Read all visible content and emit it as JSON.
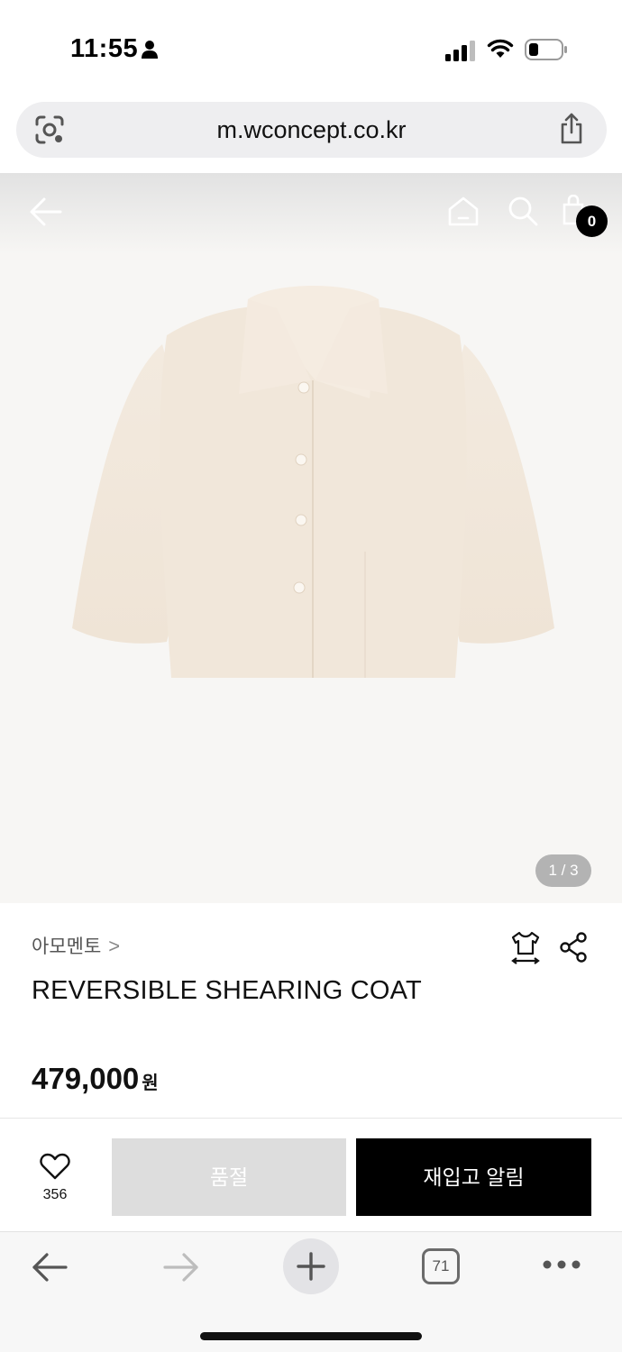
{
  "status_bar": {
    "time": "11:55"
  },
  "browser": {
    "url": "m.wconcept.co.kr",
    "tab_count": "71"
  },
  "header": {
    "cart_count": "0"
  },
  "gallery": {
    "pager": "1 / 3"
  },
  "product": {
    "brand": "아모멘토",
    "brand_chevron": ">",
    "name": "REVERSIBLE SHEARING COAT",
    "price": "479,000",
    "currency": "원"
  },
  "actions": {
    "wish_count": "356",
    "soldout_label": "품절",
    "restock_label": "재입고 알림"
  },
  "icons": {
    "person": "person-icon",
    "signal": "signal-icon",
    "wifi": "wifi-icon",
    "battery": "battery-icon",
    "lens": "camera-lens-icon",
    "share": "share-icon",
    "back": "arrow-left-icon",
    "home": "home-icon",
    "search": "search-icon",
    "bag": "shopping-bag-icon",
    "size": "size-guide-icon",
    "heart": "heart-icon",
    "plus": "plus-icon",
    "more": "more-icon"
  },
  "colors": {
    "primary_button": "#000000",
    "disabled_button": "#dddddd",
    "image_background": "#f7f6f4",
    "pager_background": "#b3b3b3"
  }
}
